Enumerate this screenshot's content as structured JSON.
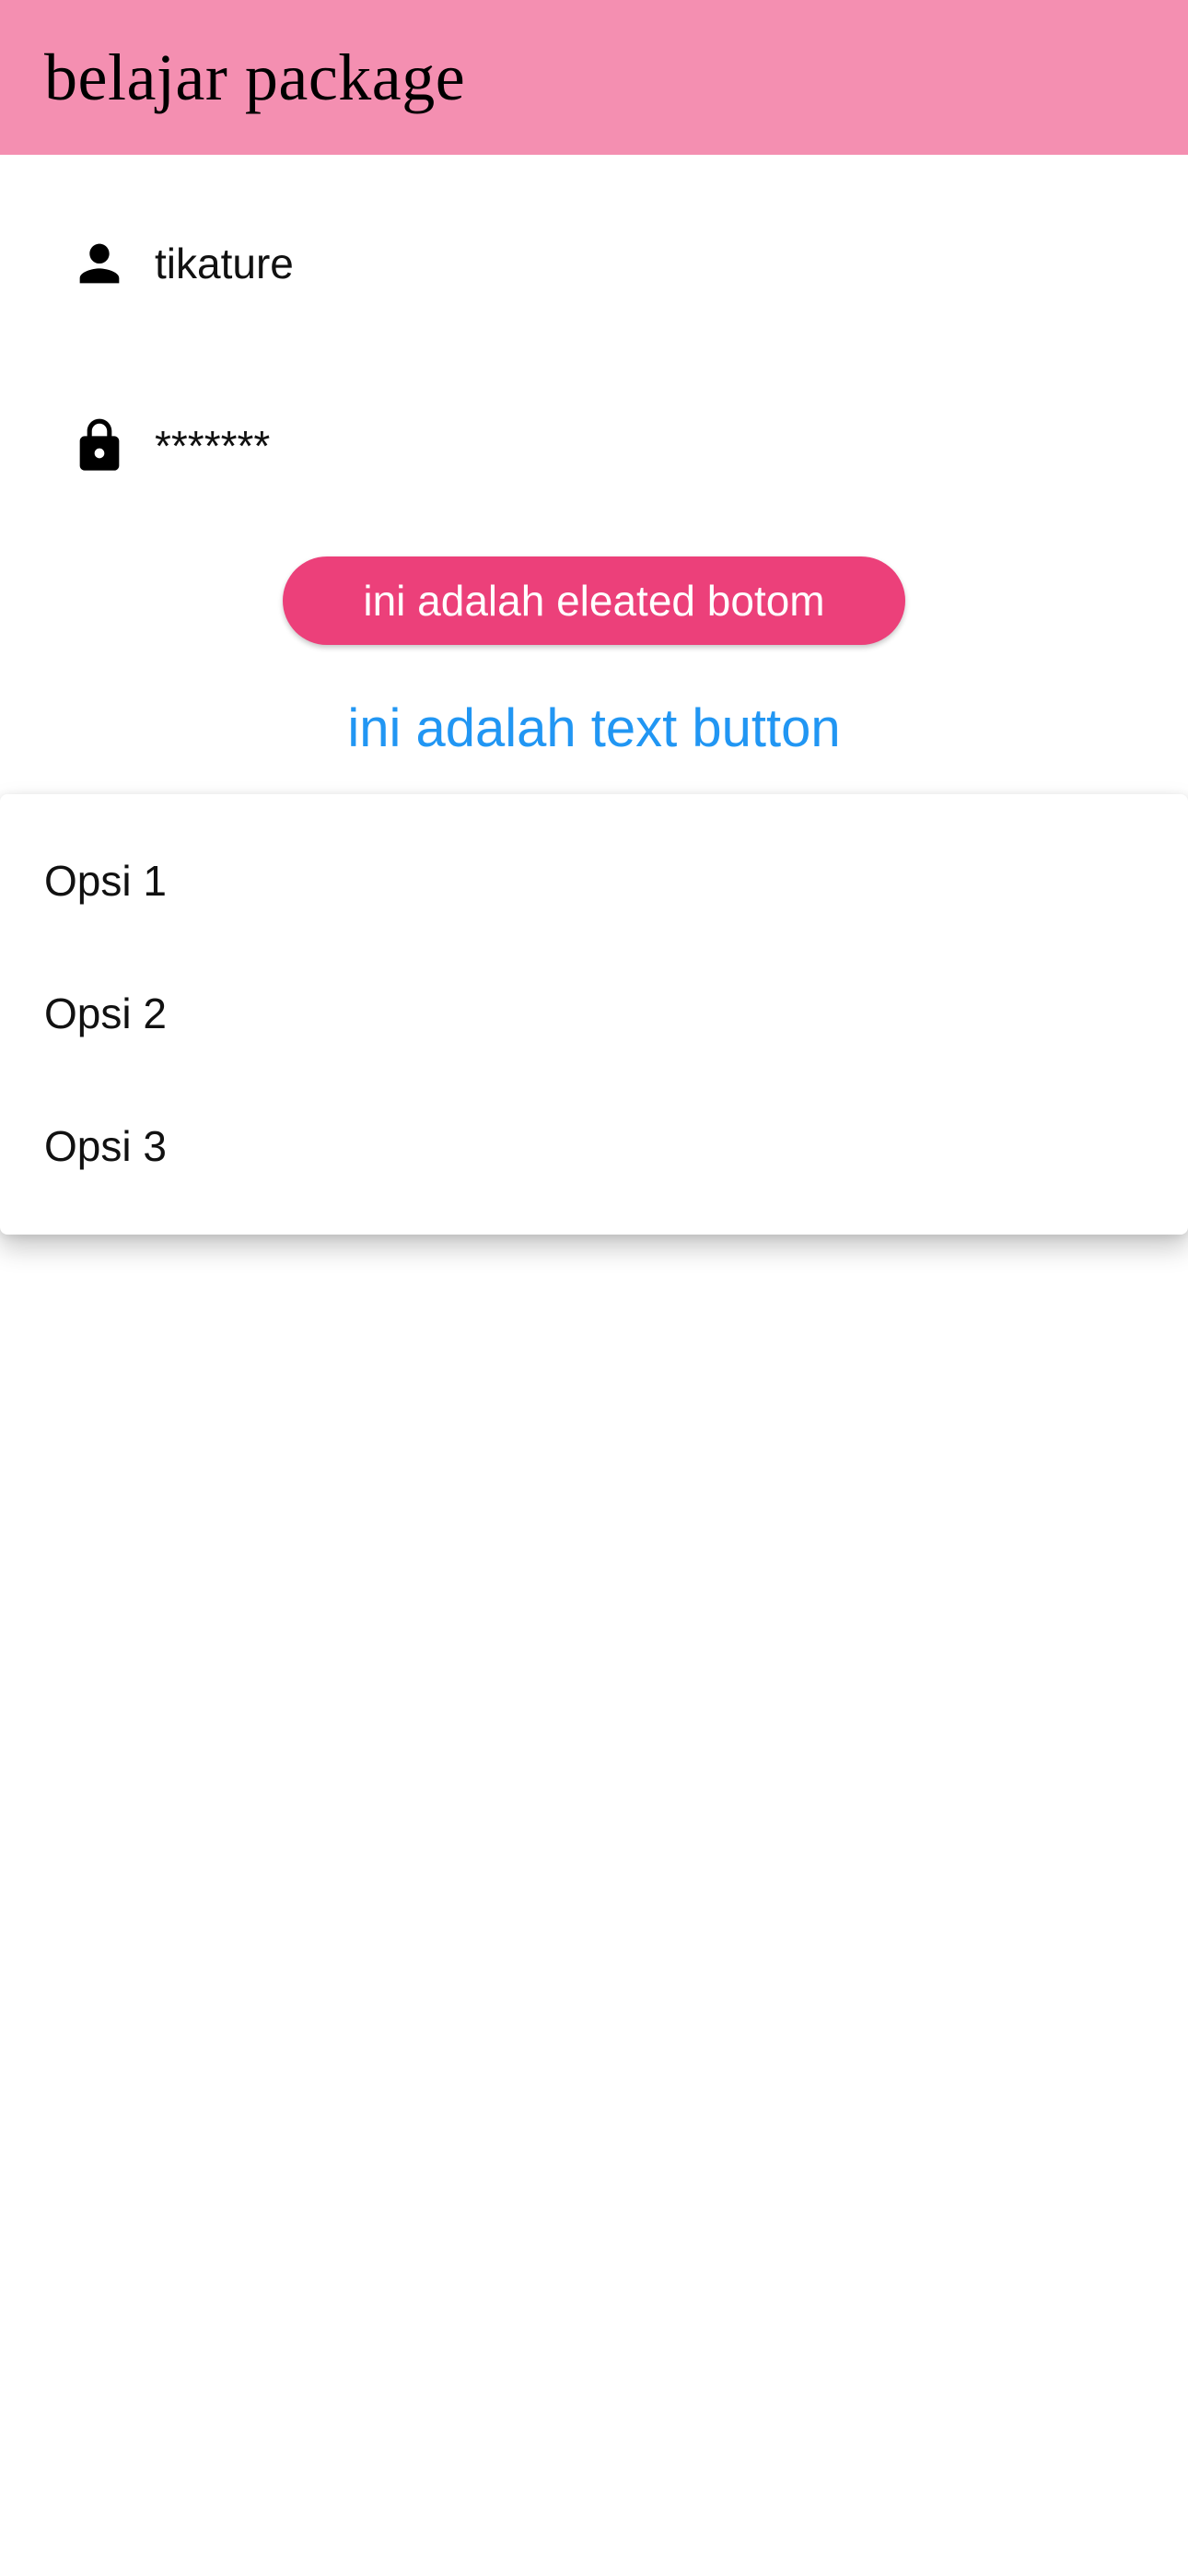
{
  "app_bar": {
    "title": "belajar package",
    "color": "#f48fb1"
  },
  "form": {
    "username": {
      "icon": "person-icon",
      "value": "tikature"
    },
    "password": {
      "icon": "lock-icon",
      "value": "*******"
    }
  },
  "buttons": {
    "elevated_label": "ini adalah eleated botom",
    "elevated_color": "#ec407a",
    "text_label": "ini adalah text button",
    "text_color": "#2196f3"
  },
  "menu": {
    "items": [
      "Opsi 1",
      "Opsi 2",
      "Opsi 3"
    ]
  }
}
